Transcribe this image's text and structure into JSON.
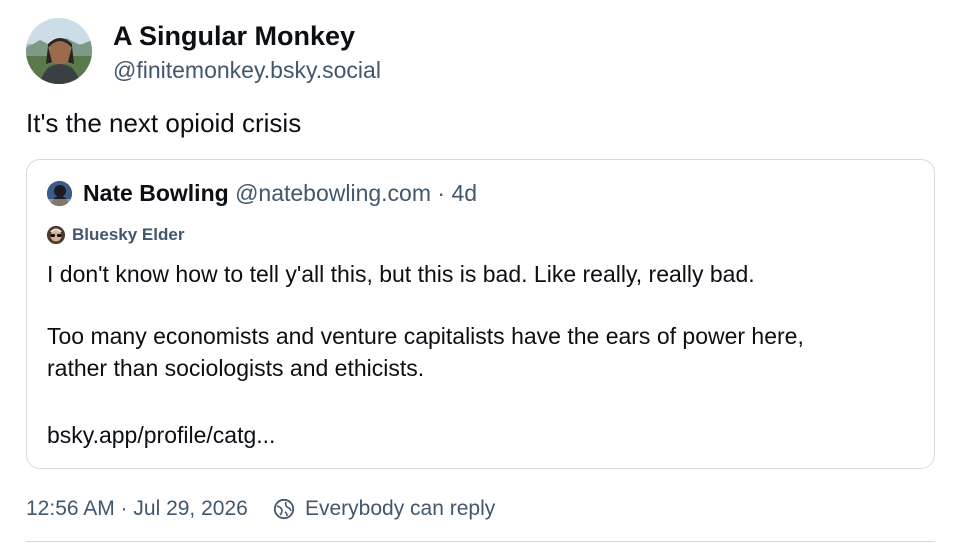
{
  "author": {
    "display_name": "A Singular Monkey",
    "handle": "@finitemonkey.bsky.social"
  },
  "post": {
    "text": "It's the next opioid crisis"
  },
  "quote": {
    "display_name": "Nate Bowling",
    "handle": "@natebowling.com",
    "separator": "·",
    "age": "4d",
    "badge": "Bluesky Elder",
    "paragraphs": [
      "I don't know how to tell y'all this, but this is bad. Like really, really bad.",
      "Too many economists and venture capitalists have the ears of power here,",
      "rather than sociologists and ethicists.",
      "bsky.app/profile/catg..."
    ]
  },
  "meta": {
    "timestamp": "12:56 AM · Jul 29, 2026",
    "reply_setting": "Everybody can reply",
    "reply_icon": "globe-icon"
  },
  "colors": {
    "text_primary": "#0b0f14",
    "text_secondary": "#42576c",
    "border": "#d4dbe2"
  }
}
